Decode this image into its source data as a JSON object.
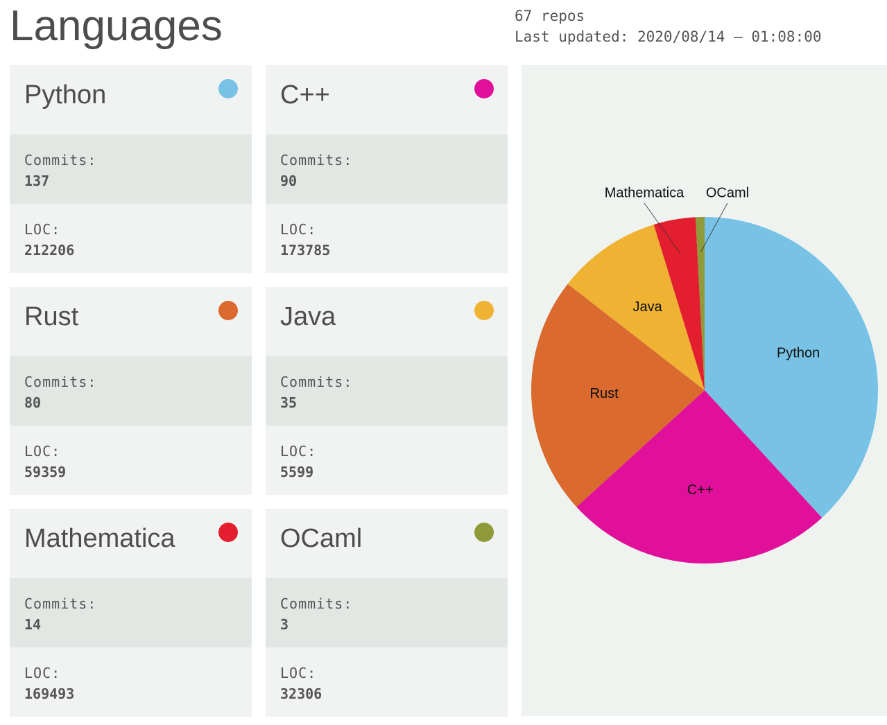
{
  "header": {
    "title": "Languages",
    "repos": "67 repos",
    "updated": "Last updated: 2020/08/14 – 01:08:00"
  },
  "cards_labels": {
    "commits": "Commits:",
    "loc": "LOC:"
  },
  "languages": [
    {
      "name": "Python",
      "color": "#78c2e6",
      "commits": "137",
      "loc": "212206"
    },
    {
      "name": "C++",
      "color": "#e0109b",
      "commits": "90",
      "loc": "173785"
    },
    {
      "name": "Rust",
      "color": "#da6a2e",
      "commits": "80",
      "loc": "59359"
    },
    {
      "name": "Java",
      "color": "#efb232",
      "commits": "35",
      "loc": "5599"
    },
    {
      "name": "Mathematica",
      "color": "#e31e2e",
      "commits": "14",
      "loc": "169493"
    },
    {
      "name": "OCaml",
      "color": "#8f9a3a",
      "commits": "3",
      "loc": "32306"
    }
  ],
  "chart_data": {
    "type": "pie",
    "title": "",
    "legend": "none",
    "start": "top, clockwise",
    "labels": [
      "Python",
      "C++",
      "Rust",
      "Java",
      "Mathematica",
      "OCaml"
    ],
    "values": [
      137,
      90,
      80,
      35,
      14,
      3
    ],
    "colors": [
      "#78c2e6",
      "#e0109b",
      "#da6a2e",
      "#efb232",
      "#e31e2e",
      "#8f9a3a"
    ],
    "outside_labels": [
      "Mathematica",
      "OCaml"
    ]
  }
}
